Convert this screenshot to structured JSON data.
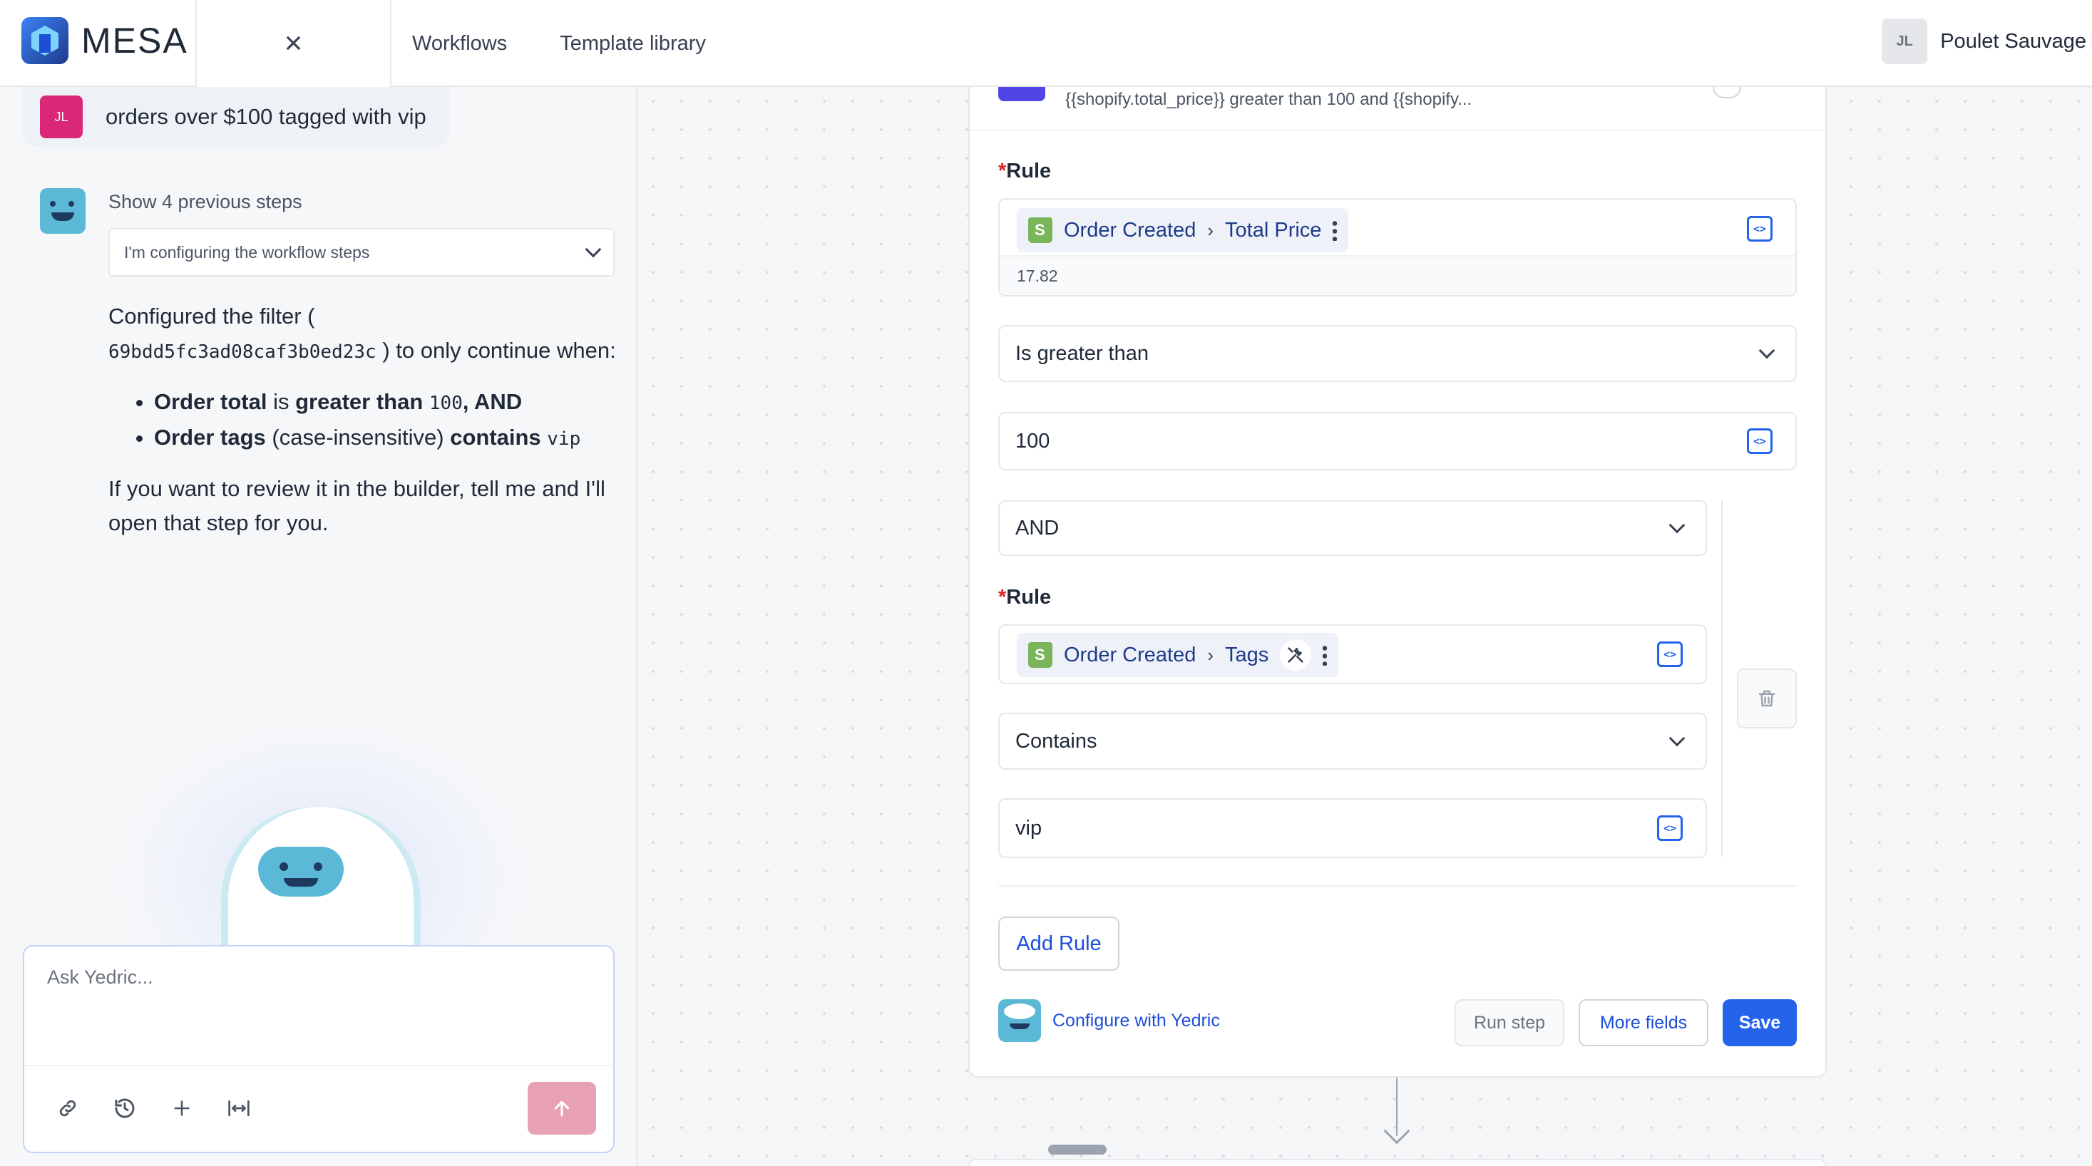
{
  "app": {
    "logo_text": "MESA",
    "close_icon": "×"
  },
  "nav": {
    "workflows": "Workflows",
    "template_library": "Template library"
  },
  "user": {
    "initials": "JL",
    "name": "Poulet Sauvage"
  },
  "chat": {
    "user_initials": "JL",
    "user_message": "orders over $100 tagged with vip",
    "show_previous": "Show 4 previous steps",
    "status_select": "I'm configuring the workflow steps",
    "msg_intro_1": "Configured the filter (",
    "filter_id": "69bdd5fc3ad08caf3b0ed23c",
    "msg_intro_2": ") to only continue when:",
    "bullet1": {
      "a": "Order total",
      "b": " is ",
      "c": "greater than",
      "code": "100",
      "d": ", AND"
    },
    "bullet2": {
      "a": "Order tags",
      "b": " (case-insensitive) ",
      "c": "contains",
      "code": "vip"
    },
    "msg_outro": "If you want to review it in the builder, tell me and I'll open that step for you.",
    "input_placeholder": "Ask Yedric..."
  },
  "card": {
    "header_desc": "{{shopify.total_price}} greater than 100 and {{shopify...",
    "rule_label": "Rule",
    "rule1": {
      "source": "Order Created",
      "field": "Total Price",
      "sample": "17.82",
      "operator": "Is greater than",
      "value": "100"
    },
    "join": "AND",
    "rule2": {
      "source": "Order Created",
      "field": "Tags",
      "operator": "Contains",
      "value": "vip"
    },
    "add_rule": "Add Rule",
    "configure_link": "Configure with Yedric",
    "run_step": "Run step",
    "more_fields": "More fields",
    "save": "Save"
  },
  "colors": {
    "accent": "#2563eb",
    "user_badge": "#db2777",
    "send_button": "#e8a0b4",
    "shopify": "#7ab55c"
  },
  "icons": [
    "close-icon",
    "link-icon",
    "history-icon",
    "plus-icon",
    "expand-width-icon",
    "send-arrow-icon",
    "shopify-icon",
    "kebab-icon",
    "wrench-icon",
    "code-icon",
    "chevron-down-icon",
    "trash-icon"
  ]
}
